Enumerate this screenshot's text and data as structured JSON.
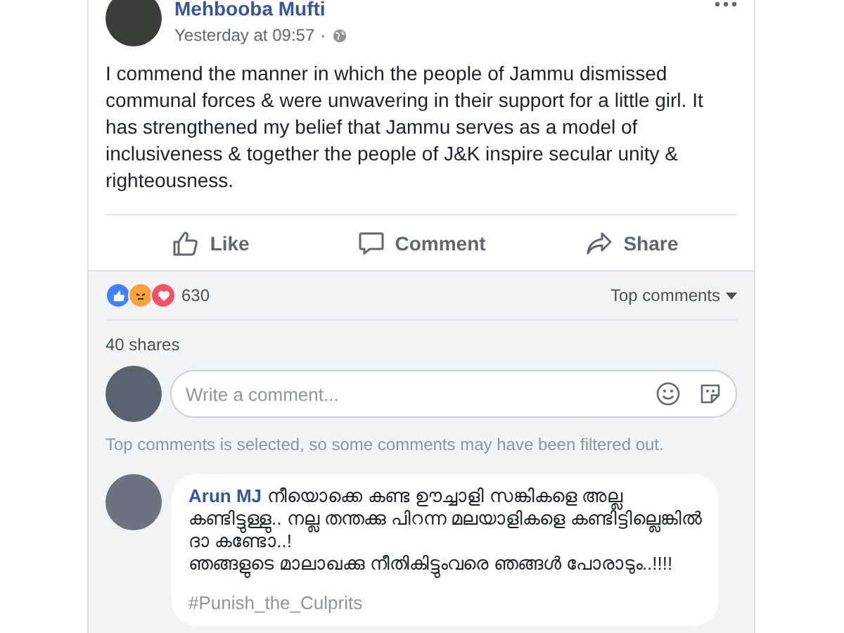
{
  "post": {
    "author": "Mehbooba Mufti",
    "time": "Yesterday at 09:57",
    "separator": "·",
    "text": "I commend the manner in which the people of Jammu dismissed communal forces & were unwavering in their support for a little girl. It has strengthened my belief that Jammu serves as a model of inclusiveness & together the people of J&K inspire secular unity & righteousness."
  },
  "actions": [
    {
      "kind": "like",
      "label": "Like"
    },
    {
      "kind": "comment",
      "label": "Comment"
    },
    {
      "kind": "share",
      "label": "Share"
    }
  ],
  "reactions": {
    "types": [
      {
        "kind": "like",
        "color": "#4080ff"
      },
      {
        "kind": "angry",
        "color": "#f7a23b"
      },
      {
        "kind": "love",
        "color": "#f25268"
      }
    ],
    "count": "630"
  },
  "sort": {
    "label": "Top comments"
  },
  "shares": "40 shares",
  "composer": {
    "placeholder": "Write a comment..."
  },
  "filter_note": "Top comments is selected, so some comments may have been filtered out.",
  "comments": [
    {
      "author": "Arun MJ",
      "lines": [
        "നീയൊക്കെ കണ്ട ഊച്ചാളി സങ്കികളെ അല്ല കണ്ടിട്ടുള്ളു.. നല്ല തന്തക്കു പിറന്ന മലയാളികളെ കണ്ടിട്ടില്ലെങ്കിൽ ദാ കണ്ടോ..!",
        "ഞങ്ങളുടെ മാലാഖക്കു നീതികിട്ടുംവരെ ഞങ്ങൾ പോരാടും..!!!!"
      ],
      "hashtag": "#Punish_the_Culprits"
    }
  ]
}
